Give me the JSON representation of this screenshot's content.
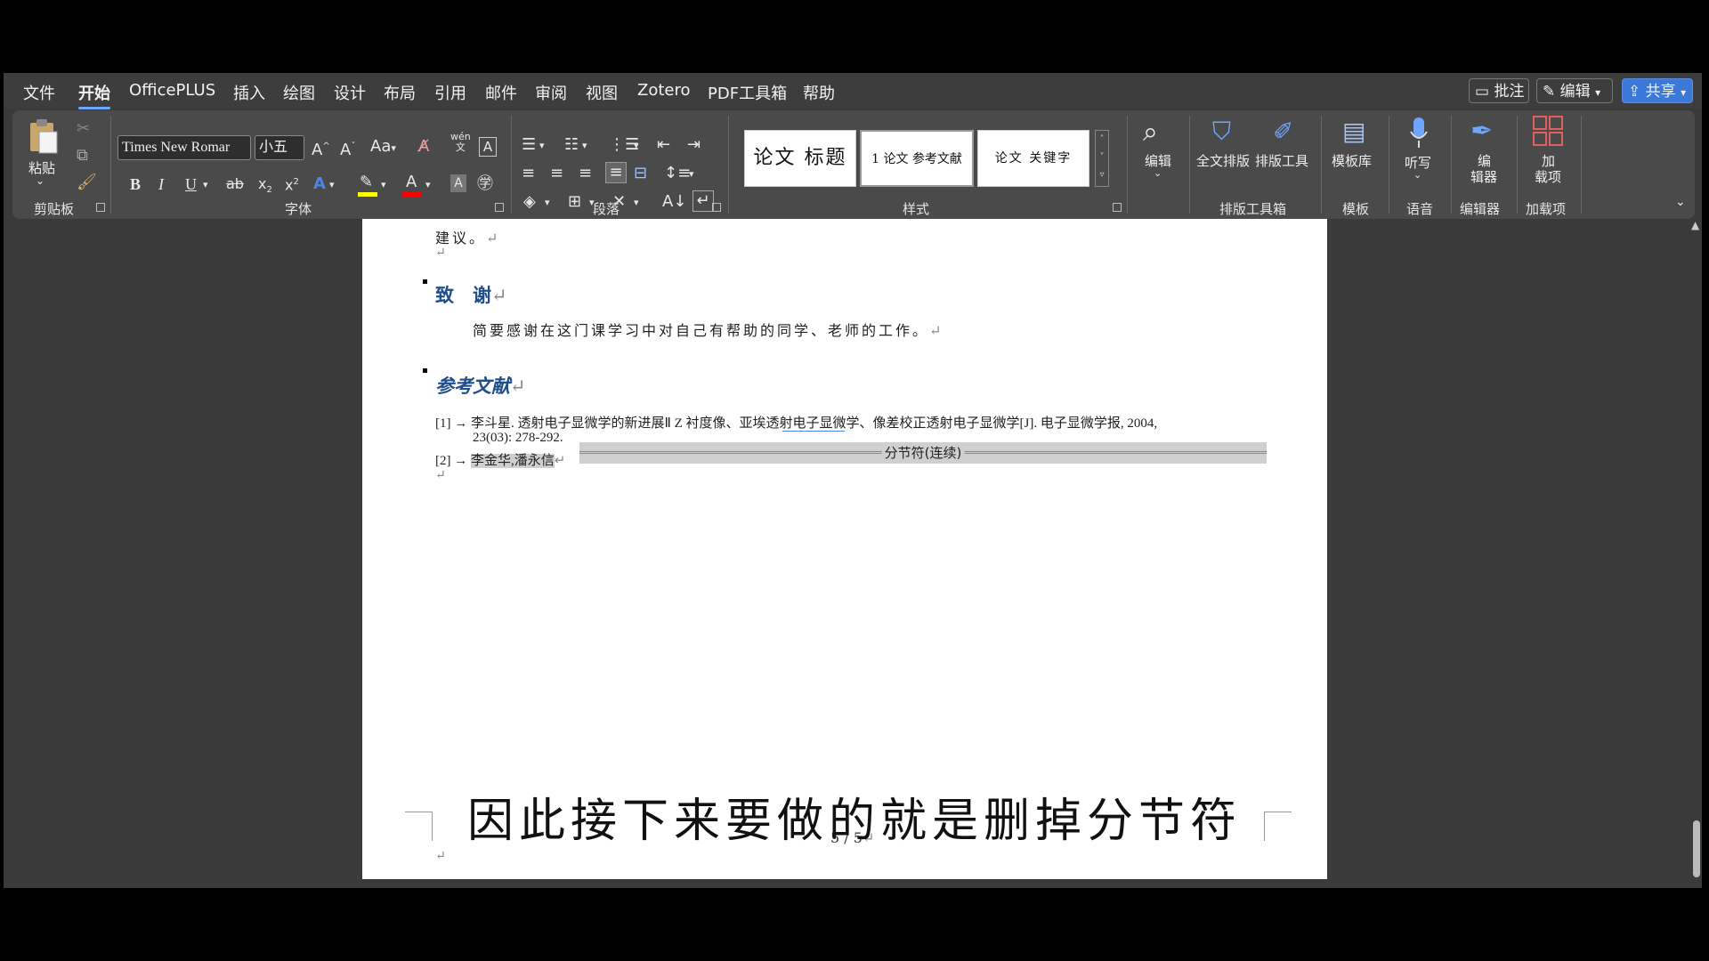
{
  "menu": {
    "tabs": [
      "文件",
      "开始",
      "OfficePLUS",
      "插入",
      "绘图",
      "设计",
      "布局",
      "引用",
      "邮件",
      "审阅",
      "视图",
      "Zotero",
      "PDF工具箱",
      "帮助"
    ],
    "comment_btn": "批注",
    "edit_btn": "编辑",
    "share_btn": "共享"
  },
  "ribbon": {
    "clipboard": {
      "paste_label": "粘贴",
      "group_label": "剪贴板"
    },
    "font": {
      "font_name": "Times New Romar",
      "font_size": "小五",
      "group_label": "字体",
      "aa_label": "Aa",
      "wen_label": "wén",
      "wen_char": "文"
    },
    "paragraph": {
      "group_label": "段落"
    },
    "styles": {
      "items": [
        "论文 标题",
        "1 论文 参考文献",
        "论文 关键字"
      ],
      "group_label": "样式"
    },
    "editing": {
      "label": "编辑"
    },
    "layout_tools": {
      "full_text": "全文排版",
      "layout_tool": "排版工具",
      "group_label": "排版工具箱"
    },
    "template": {
      "label": "模板库",
      "group_label": "模板"
    },
    "voice": {
      "label": "听写",
      "group_label": "语音"
    },
    "editor": {
      "label_1": "编",
      "label_2": "辑器",
      "group_label": "编辑器"
    },
    "addins": {
      "label_1": "加",
      "label_2": "载项",
      "group_label": "加载项"
    }
  },
  "colors": {
    "highlight": "#ffff00",
    "font_color": "#ff0000",
    "heading": "#1f4e8c",
    "accent": "#3c78d8"
  },
  "document": {
    "line_jianyi": "建议。",
    "ack_heading": "致　谢",
    "ack_body": "简要感谢在这门课学习中对自己有帮助的同学、老师的工作。",
    "ref_heading": "参考文献",
    "ref1_num": "[1] →",
    "ref1_text": "李斗星. 透射电子显微学的新进展Ⅱ Z 衬度像、亚埃透射电子显微学、像差校正透射电子显微学[J]. 电子显微学报, 2004,",
    "ref1_cont": "23(03): 278-292.",
    "section_break": "分节符(连续)",
    "ref2_num": "[2] →",
    "ref2_text": "李金华,潘永信",
    "page_number": "5 / 5"
  },
  "subtitle": "因此接下来要做的就是删掉分节符"
}
